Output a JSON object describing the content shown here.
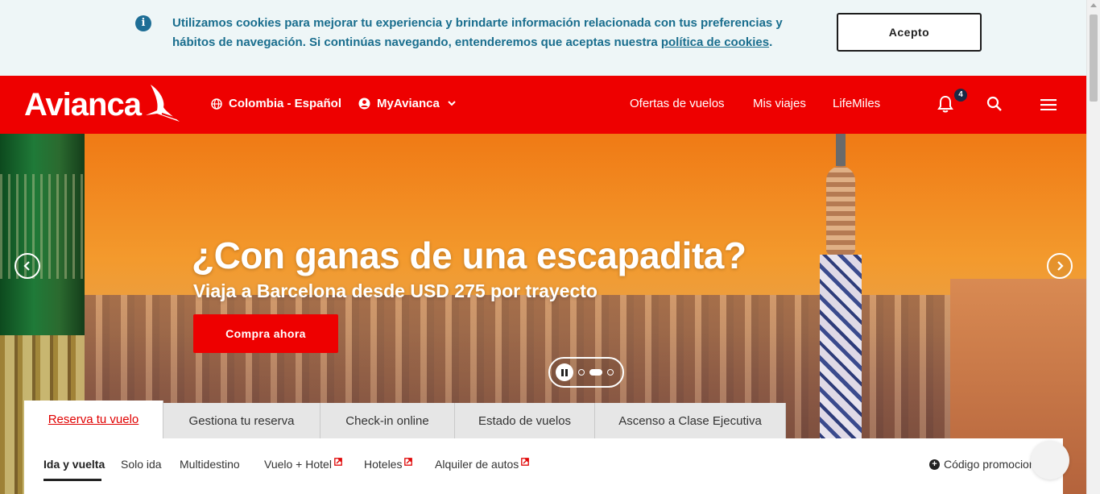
{
  "cookie_banner": {
    "text_line1": "Utilizamos cookies para mejorar tu experiencia y brindarte información relacionada con tus preferencias y",
    "text_line2": "hábitos de navegación. Si continúas navegando, entenderemos que aceptas nuestra",
    "link_text": "política de cookies",
    "period": ".",
    "accept_label": "Acepto",
    "icon": "info-icon"
  },
  "header": {
    "logo_text": "Avianca",
    "country_label": "Colombia - Español",
    "account_label": "MyAvianca",
    "nav": [
      "Ofertas de vuelos",
      "Mis viajes",
      "LifeMiles"
    ],
    "notification_count": "4",
    "brand_color": "#ee0000"
  },
  "hero": {
    "title": "¿Con ganas de una escapadita?",
    "subtitle": "Viaja a Barcelona desde USD 275 por trayecto",
    "cta_label": "Compra ahora",
    "slide_count": 3,
    "active_slide": 2
  },
  "booking": {
    "tabs": [
      "Reserva tu vuelo",
      "Gestiona tu reserva",
      "Check-in online",
      "Estado de vuelos",
      "Ascenso a Clase Ejecutiva"
    ],
    "active_tab": 0,
    "subtabs": [
      "Ida y vuelta",
      "Solo ida",
      "Multidestino",
      "Vuelo + Hotel",
      "Hoteles",
      "Alquiler de autos"
    ],
    "promo_label": "Código promocion"
  }
}
